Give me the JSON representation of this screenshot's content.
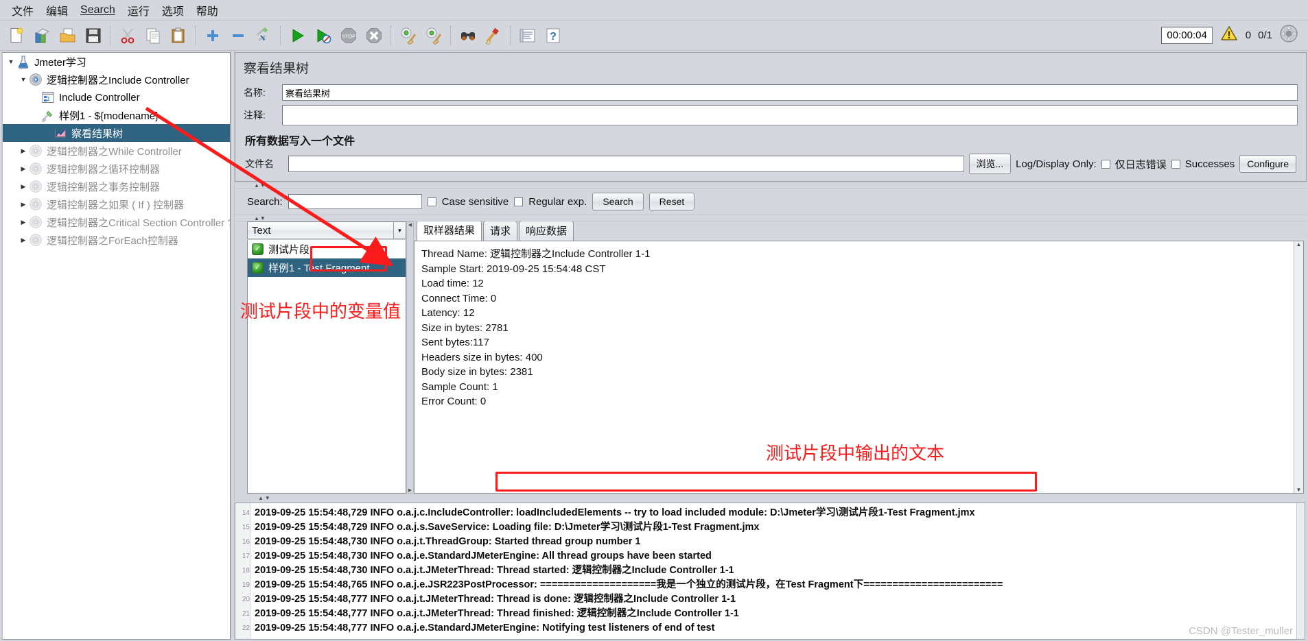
{
  "menubar": {
    "items": [
      {
        "label": "文件",
        "underline": false
      },
      {
        "label": "编辑",
        "underline": false
      },
      {
        "label": "Search",
        "underline": true
      },
      {
        "label": "运行",
        "underline": false
      },
      {
        "label": "选项",
        "underline": false
      },
      {
        "label": "帮助",
        "underline": false
      }
    ]
  },
  "toolbar": {
    "icons": [
      {
        "name": "new-icon"
      },
      {
        "name": "templates-icon"
      },
      {
        "name": "open-icon"
      },
      {
        "name": "save-icon"
      },
      {
        "name": "cut-icon"
      },
      {
        "name": "copy-icon"
      },
      {
        "name": "paste-icon"
      },
      {
        "name": "expand-all-icon"
      },
      {
        "name": "collapse-all-icon"
      },
      {
        "name": "toggle-icon"
      },
      {
        "name": "start-icon"
      },
      {
        "name": "start-no-timers-icon"
      },
      {
        "name": "stop-icon"
      },
      {
        "name": "shutdown-icon"
      },
      {
        "name": "clear-icon"
      },
      {
        "name": "clear-all-icon"
      },
      {
        "name": "search-icon"
      },
      {
        "name": "search-reset-icon"
      },
      {
        "name": "function-helper-icon"
      },
      {
        "name": "help-icon"
      }
    ],
    "timer": "00:00:04",
    "warning_count": "0",
    "thread_ratio": "0/1",
    "warning_icon": "warning-triangle-icon",
    "threads_icon": "threads-gauge-icon"
  },
  "tree": {
    "nodes": [
      {
        "label": "Jmeter学习",
        "indent": 0,
        "twisty": "▼",
        "icon": "test-plan-flask-icon",
        "selected": false,
        "disabled": false
      },
      {
        "label": "逻辑控制器之Include Controller",
        "indent": 1,
        "twisty": "▼",
        "icon": "thread-group-gear-icon",
        "selected": false,
        "disabled": false
      },
      {
        "label": "Include Controller",
        "indent": 2,
        "twisty": "",
        "icon": "include-controller-icon",
        "selected": false,
        "disabled": false
      },
      {
        "label": "样例1 - ${modename}",
        "indent": 2,
        "twisty": "",
        "icon": "sampler-pipette-icon",
        "selected": false,
        "disabled": false
      },
      {
        "label": "察看结果树",
        "indent": 3,
        "twisty": "",
        "icon": "view-results-tree-icon",
        "selected": true,
        "disabled": false
      },
      {
        "label": "逻辑控制器之While Controller",
        "indent": 1,
        "twisty": "▶",
        "icon": "thread-group-gear-icon",
        "selected": false,
        "disabled": true
      },
      {
        "label": "逻辑控制器之循环控制器",
        "indent": 1,
        "twisty": "▶",
        "icon": "thread-group-gear-icon",
        "selected": false,
        "disabled": true
      },
      {
        "label": "逻辑控制器之事务控制器",
        "indent": 1,
        "twisty": "▶",
        "icon": "thread-group-gear-icon",
        "selected": false,
        "disabled": true
      },
      {
        "label": "逻辑控制器之如果 ( If ) 控制器",
        "indent": 1,
        "twisty": "▶",
        "icon": "thread-group-gear-icon",
        "selected": false,
        "disabled": true
      },
      {
        "label": "逻辑控制器之Critical Section Controller ?",
        "indent": 1,
        "twisty": "▶",
        "icon": "thread-group-gear-icon",
        "selected": false,
        "disabled": true
      },
      {
        "label": "逻辑控制器之ForEach控制器",
        "indent": 1,
        "twisty": "▶",
        "icon": "thread-group-gear-icon",
        "selected": false,
        "disabled": true
      }
    ]
  },
  "panel": {
    "title": "察看结果树",
    "name_label": "名称:",
    "name_value": "察看结果树",
    "comment_label": "注释:",
    "comment_value": "",
    "write_section_title": "所有数据写入一个文件",
    "filename_label": "文件名",
    "filename_value": "",
    "browse_button": "浏览...",
    "log_display_label": "Log/Display Only:",
    "errors_only_label": "仅日志错误",
    "errors_only_checked": false,
    "successes_label": "Successes",
    "successes_checked": false,
    "configure_button": "Configure"
  },
  "search": {
    "label": "Search:",
    "value": "",
    "case_sensitive_label": "Case sensitive",
    "case_sensitive_checked": false,
    "regular_exp_label": "Regular exp.",
    "regular_exp_checked": false,
    "search_button": "Search",
    "reset_button": "Reset"
  },
  "results": {
    "renderer_selected": "Text",
    "items": [
      {
        "label": "测试片段",
        "selected": false,
        "status_icon": "success-shield-icon"
      },
      {
        "label": "样例1 - Test Fragment",
        "selected": true,
        "status_icon": "success-shield-icon"
      }
    ],
    "tabs": [
      {
        "label": "取样器结果",
        "active": true
      },
      {
        "label": "请求",
        "active": false
      },
      {
        "label": "响应数据",
        "active": false
      }
    ],
    "detail_lines": [
      "Thread Name: 逻辑控制器之Include Controller 1-1",
      "Sample Start: 2019-09-25 15:54:48 CST",
      "Load time: 12",
      "Connect Time: 0",
      "Latency: 12",
      "Size in bytes: 2781",
      "Sent bytes:117",
      "Headers size in bytes: 400",
      "Body size in bytes: 2381",
      "Sample Count: 1",
      "Error Count: 0"
    ]
  },
  "log": {
    "lines": [
      {
        "num": "14",
        "text": "2019-09-25 15:54:48,729 INFO o.a.j.c.IncludeController: loadIncludedElements -- try to load included module: D:\\Jmeter学习\\测试片段1-Test Fragment.jmx"
      },
      {
        "num": "15",
        "text": "2019-09-25 15:54:48,729 INFO o.a.j.s.SaveService: Loading file: D:\\Jmeter学习\\测试片段1-Test Fragment.jmx"
      },
      {
        "num": "16",
        "text": "2019-09-25 15:54:48,730 INFO o.a.j.t.ThreadGroup: Started thread group number 1"
      },
      {
        "num": "17",
        "text": "2019-09-25 15:54:48,730 INFO o.a.j.e.StandardJMeterEngine: All thread groups have been started"
      },
      {
        "num": "18",
        "text": "2019-09-25 15:54:48,730 INFO o.a.j.t.JMeterThread: Thread started: 逻辑控制器之Include Controller 1-1"
      },
      {
        "num": "19",
        "text": "2019-09-25 15:54:48,765 INFO o.a.j.e.JSR223PostProcessor: ====================我是一个独立的测试片段，在Test Fragment下========================"
      },
      {
        "num": "20",
        "text": "2019-09-25 15:54:48,777 INFO o.a.j.t.JMeterThread: Thread is done: 逻辑控制器之Include Controller 1-1"
      },
      {
        "num": "21",
        "text": "2019-09-25 15:54:48,777 INFO o.a.j.t.JMeterThread: Thread finished: 逻辑控制器之Include Controller 1-1"
      },
      {
        "num": "22",
        "text": "2019-09-25 15:54:48,777 INFO o.a.j.e.StandardJMeterEngine: Notifying test listeners of end of test"
      }
    ]
  },
  "annotations": {
    "variable_note": "测试片段中的变量值",
    "output_note": "测试片段中输出的文本",
    "watermark": "CSDN @Tester_muller"
  }
}
